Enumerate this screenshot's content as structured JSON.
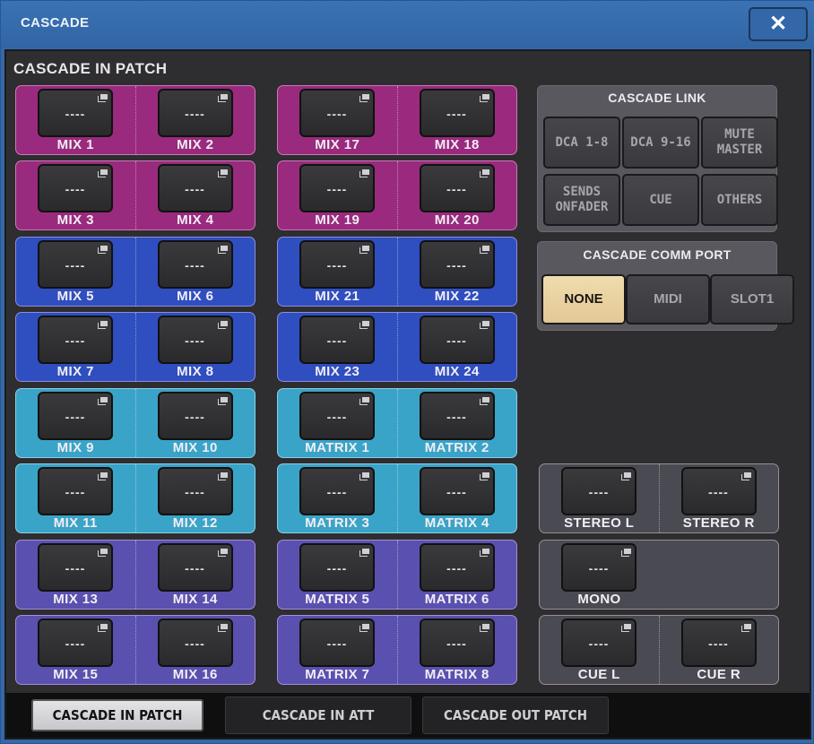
{
  "window": {
    "title": "CASCADE",
    "close_icon": "close-x-icon"
  },
  "section_title": "CASCADE IN PATCH",
  "patch_placeholder": "----",
  "patch_icon": "popup-window-icon",
  "colors": {
    "magenta": "#9a2a7e",
    "blue": "#2f4ec0",
    "cyan": "#3aa4c8",
    "violet": "#5a50b0",
    "gray": "#4a4a52",
    "active_port": "#e8d2a0"
  },
  "patch_left": [
    {
      "color": "magenta",
      "channels": [
        {
          "label": "MIX 1",
          "value": "----"
        },
        {
          "label": "MIX 2",
          "value": "----"
        }
      ]
    },
    {
      "color": "magenta",
      "channels": [
        {
          "label": "MIX 3",
          "value": "----"
        },
        {
          "label": "MIX 4",
          "value": "----"
        }
      ]
    },
    {
      "color": "blue",
      "channels": [
        {
          "label": "MIX 5",
          "value": "----"
        },
        {
          "label": "MIX 6",
          "value": "----"
        }
      ]
    },
    {
      "color": "blue",
      "channels": [
        {
          "label": "MIX 7",
          "value": "----"
        },
        {
          "label": "MIX 8",
          "value": "----"
        }
      ]
    },
    {
      "color": "cyan",
      "channels": [
        {
          "label": "MIX 9",
          "value": "----"
        },
        {
          "label": "MIX 10",
          "value": "----"
        }
      ]
    },
    {
      "color": "cyan",
      "channels": [
        {
          "label": "MIX 11",
          "value": "----"
        },
        {
          "label": "MIX 12",
          "value": "----"
        }
      ]
    },
    {
      "color": "violet",
      "channels": [
        {
          "label": "MIX 13",
          "value": "----"
        },
        {
          "label": "MIX 14",
          "value": "----"
        }
      ]
    },
    {
      "color": "violet",
      "channels": [
        {
          "label": "MIX 15",
          "value": "----"
        },
        {
          "label": "MIX 16",
          "value": "----"
        }
      ]
    }
  ],
  "patch_middle": [
    {
      "color": "magenta",
      "channels": [
        {
          "label": "MIX 17",
          "value": "----"
        },
        {
          "label": "MIX 18",
          "value": "----"
        }
      ]
    },
    {
      "color": "magenta",
      "channels": [
        {
          "label": "MIX 19",
          "value": "----"
        },
        {
          "label": "MIX 20",
          "value": "----"
        }
      ]
    },
    {
      "color": "blue",
      "channels": [
        {
          "label": "MIX 21",
          "value": "----"
        },
        {
          "label": "MIX 22",
          "value": "----"
        }
      ]
    },
    {
      "color": "blue",
      "channels": [
        {
          "label": "MIX 23",
          "value": "----"
        },
        {
          "label": "MIX 24",
          "value": "----"
        }
      ]
    },
    {
      "color": "cyan",
      "channels": [
        {
          "label": "MATRIX 1",
          "value": "----"
        },
        {
          "label": "MATRIX 2",
          "value": "----"
        }
      ]
    },
    {
      "color": "cyan",
      "channels": [
        {
          "label": "MATRIX 3",
          "value": "----"
        },
        {
          "label": "MATRIX 4",
          "value": "----"
        }
      ]
    },
    {
      "color": "violet",
      "channels": [
        {
          "label": "MATRIX 5",
          "value": "----"
        },
        {
          "label": "MATRIX 6",
          "value": "----"
        }
      ]
    },
    {
      "color": "violet",
      "channels": [
        {
          "label": "MATRIX 7",
          "value": "----"
        },
        {
          "label": "MATRIX 8",
          "value": "----"
        }
      ]
    }
  ],
  "patch_right": [
    {
      "color": "gray",
      "channels": [
        {
          "label": "STEREO L",
          "value": "----"
        },
        {
          "label": "STEREO R",
          "value": "----"
        }
      ]
    },
    {
      "color": "gray",
      "channels": [
        {
          "label": "MONO",
          "value": "----"
        }
      ]
    },
    {
      "color": "gray",
      "channels": [
        {
          "label": "CUE L",
          "value": "----"
        },
        {
          "label": "CUE R",
          "value": "----"
        }
      ]
    }
  ],
  "cascade_link": {
    "title": "CASCADE LINK",
    "buttons": [
      {
        "label": "DCA 1-8",
        "active": false
      },
      {
        "label": "DCA 9-16",
        "active": false
      },
      {
        "label": "MUTE\nMASTER",
        "active": false
      },
      {
        "label": "SENDS\nONFADER",
        "active": false
      },
      {
        "label": "CUE",
        "active": false
      },
      {
        "label": "OTHERS",
        "active": false
      }
    ]
  },
  "comm_port": {
    "title": "CASCADE COMM PORT",
    "options": [
      {
        "label": "NONE",
        "active": true
      },
      {
        "label": "MIDI",
        "active": false
      },
      {
        "label": "SLOT1",
        "active": false
      }
    ]
  },
  "tabs": [
    {
      "label": "CASCADE IN PATCH",
      "active": true
    },
    {
      "label": "CASCADE IN ATT",
      "active": false
    },
    {
      "label": "CASCADE OUT PATCH",
      "active": false
    }
  ]
}
